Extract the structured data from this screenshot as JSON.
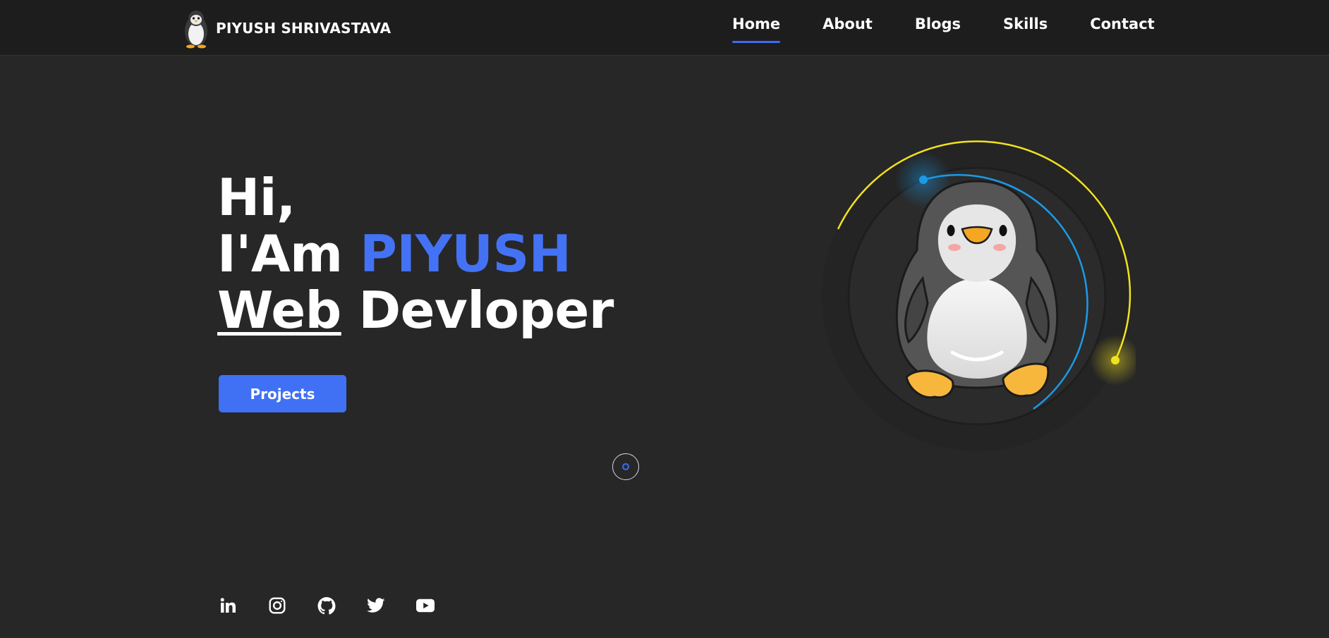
{
  "brand": {
    "name": "PIYUSH SHRIVASTAVA",
    "logo_icon": "penguin-icon"
  },
  "nav": {
    "items": [
      {
        "label": "Home",
        "active": true
      },
      {
        "label": "About",
        "active": false
      },
      {
        "label": "Blogs",
        "active": false
      },
      {
        "label": "Skills",
        "active": false
      },
      {
        "label": "Contact",
        "active": false
      }
    ]
  },
  "hero": {
    "greeting": "Hi,",
    "intro_prefix": "I'Am",
    "name": "PIYUSH",
    "role_underlined": "Web",
    "role_rest": "Devloper",
    "button_label": "Projects"
  },
  "socials": [
    {
      "icon": "linkedin-icon"
    },
    {
      "icon": "instagram-icon"
    },
    {
      "icon": "github-icon"
    },
    {
      "icon": "twitter-icon"
    },
    {
      "icon": "youtube-icon"
    }
  ],
  "colors": {
    "background": "#272727",
    "navbar": "#1d1d1d",
    "accent": "#4070f4",
    "ring_outer": "#f2e21d",
    "ring_inner": "#1a9be8"
  }
}
